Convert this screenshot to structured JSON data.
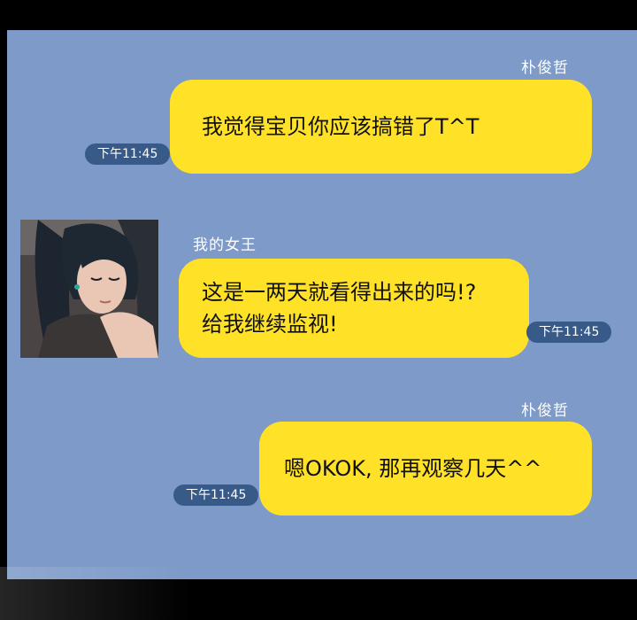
{
  "messages": [
    {
      "sender": "朴俊哲",
      "text": "我觉得宝贝你应该搞错了T^T",
      "time": "下午11:45"
    },
    {
      "sender": "我的女王",
      "lines": [
        "这是一两天就看得出来的吗!?",
        "给我继续监视!"
      ],
      "time": "下午11:45"
    },
    {
      "sender": "朴俊哲",
      "text": "嗯OKOK, 那再观察几天^^",
      "time": "下午11:45"
    }
  ],
  "colors": {
    "chat_background": "#7d9ac8",
    "bubble": "#ffe227",
    "timestamp_pill": "#375a88"
  }
}
